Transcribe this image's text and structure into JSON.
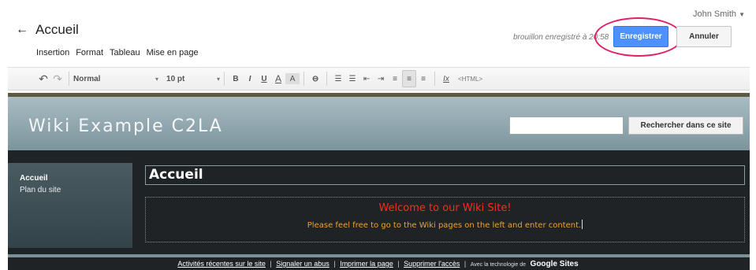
{
  "header": {
    "user_name": "John Smith",
    "user_caret": "▼",
    "back_arrow": "←",
    "page_name": "Accueil",
    "saved_status": "brouillon enregistré à 20:58",
    "save_label": "Enregistrer",
    "cancel_label": "Annuler"
  },
  "menu": {
    "items": [
      "Insertion",
      "Format",
      "Tableau",
      "Mise en page"
    ]
  },
  "toolbar": {
    "undo": "↶",
    "redo": "↷",
    "style_value": "Normal",
    "size_value": "10 pt",
    "caret": "▾",
    "bold": "B",
    "italic": "I",
    "underline": "U",
    "text_color": "A",
    "highlight": "A",
    "link": "⊖",
    "numbered_list": "☰",
    "bullet_list": "☰",
    "indent_less": "⇤",
    "indent_more": "⇥",
    "align_left": "≡",
    "align_center": "≡",
    "align_right": "≡",
    "clear_format": "Ix",
    "html_label": "<HTML>"
  },
  "site": {
    "title": "Wiki Example C2LA",
    "search_button": "Rechercher dans ce site",
    "nav": [
      "Accueil",
      "Plan du site"
    ],
    "page_title": "Accueil",
    "welcome": "Welcome to our Wiki Site!",
    "content": "Please feel free to go to the Wiki pages on the left and enter content."
  },
  "footer": {
    "links": [
      "Activités récentes sur le site",
      "Signaler un abus",
      "Imprimer la page",
      "Supprimer l'accès"
    ],
    "powered": "Avec la technologie de",
    "brand": "Google Sites",
    "separator": "|"
  },
  "colors": {
    "save_button": "#4d90fe",
    "highlight_circle": "#e0206a",
    "welcome_text": "#ff2a1a",
    "content_text": "#f0a030"
  }
}
